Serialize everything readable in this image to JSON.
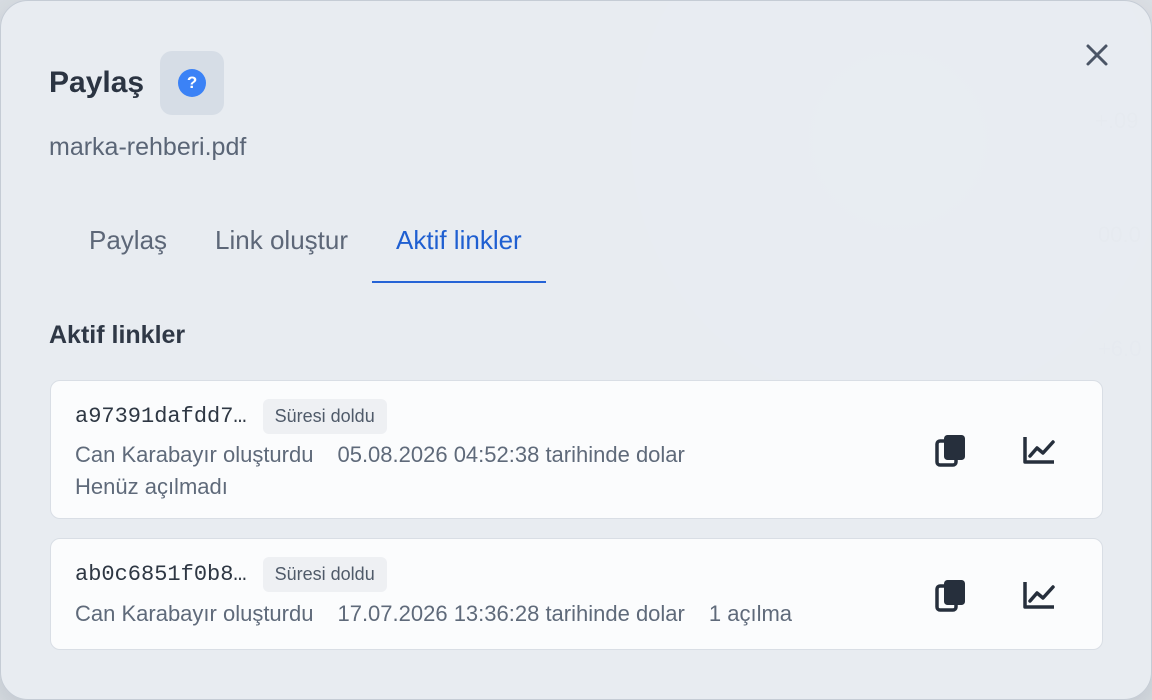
{
  "dialog": {
    "title": "Paylaş",
    "file_name": "marka-rehberi.pdf"
  },
  "tabs": [
    {
      "label": "Paylaş",
      "active": false
    },
    {
      "label": "Link oluştur",
      "active": false
    },
    {
      "label": "Aktif linkler",
      "active": true
    }
  ],
  "section": {
    "title": "Aktif linkler"
  },
  "links": [
    {
      "id": "a97391dafdd7…",
      "status": "Süresi doldu",
      "creator": "Can Karabayır oluşturdu",
      "expiry": "05.08.2026 04:52:38 tarihinde dolar",
      "views": "Henüz açılmadı"
    },
    {
      "id": "ab0c6851f0b8…",
      "status": "Süresi doldu",
      "creator": "Can Karabayır oluşturdu",
      "expiry": "17.07.2026 13:36:28 tarihinde dolar",
      "views": "1 açılma"
    }
  ],
  "icons": {
    "close": "close-icon",
    "help": "help-icon",
    "copy": "copy-icon",
    "stats": "chart-line-icon"
  },
  "colors": {
    "accent": "#2563d6",
    "help": "#3b82f6"
  }
}
